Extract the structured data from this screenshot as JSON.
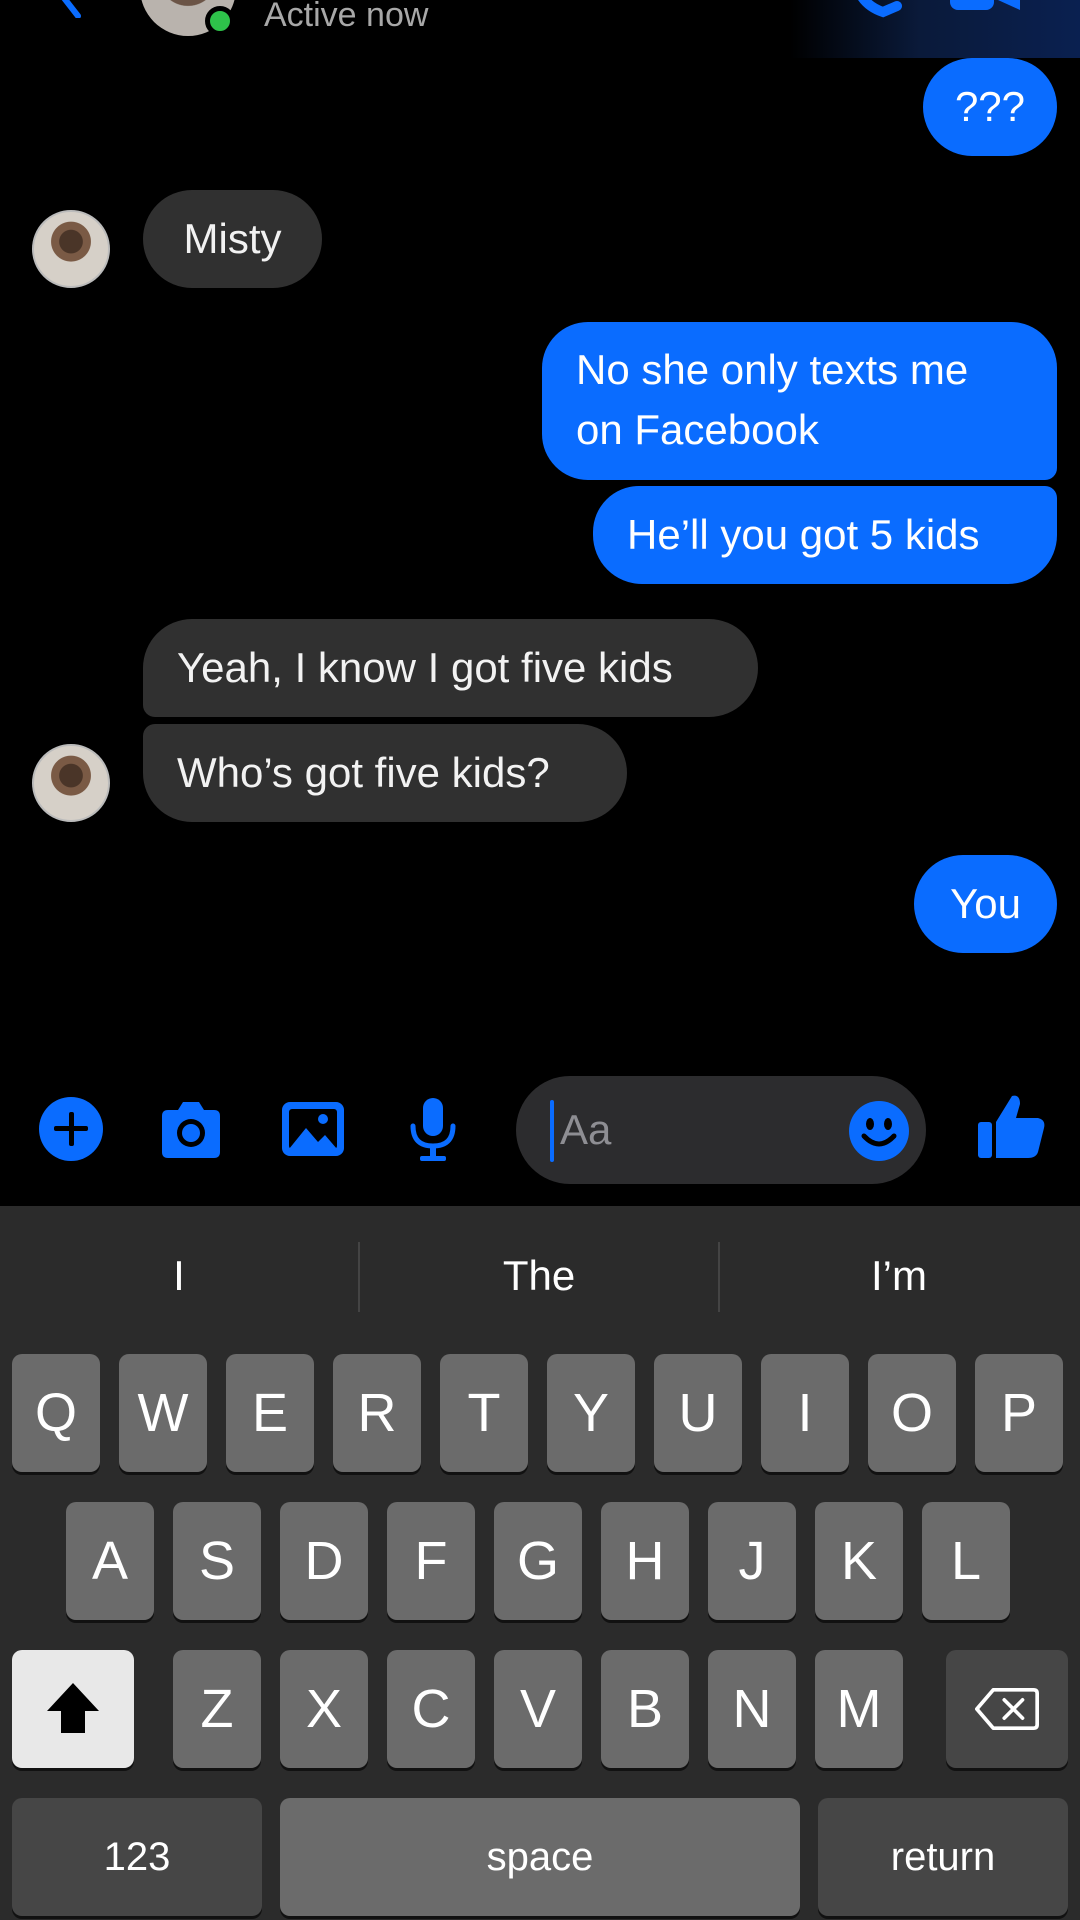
{
  "header": {
    "status": "Active now"
  },
  "messages": [
    {
      "side": "out",
      "text": "???"
    },
    {
      "side": "in",
      "text": "Misty"
    },
    {
      "side": "out",
      "text": "No she only texts me"
    },
    {
      "side": "out",
      "text": "on Facebook"
    },
    {
      "side": "out",
      "text": "He’ll you got 5 kids"
    },
    {
      "side": "in",
      "text": "Yeah, I know I got five kids"
    },
    {
      "side": "in",
      "text": "Who’s got five kids?"
    },
    {
      "side": "out",
      "text": "You"
    }
  ],
  "composer": {
    "placeholder": "Aa"
  },
  "keyboard": {
    "suggestions": [
      "I",
      "The",
      "I’m"
    ],
    "row1": [
      "Q",
      "W",
      "E",
      "R",
      "T",
      "Y",
      "U",
      "I",
      "O",
      "P"
    ],
    "row2": [
      "A",
      "S",
      "D",
      "F",
      "G",
      "H",
      "J",
      "K",
      "L"
    ],
    "row3": [
      "Z",
      "X",
      "C",
      "V",
      "B",
      "N",
      "M"
    ],
    "numbers_label": "123",
    "space_label": "space",
    "return_label": "return"
  },
  "colors": {
    "accent": "#0a6cff",
    "incoming_bubble": "#303030",
    "background": "#000000",
    "online": "#2ec24a"
  }
}
